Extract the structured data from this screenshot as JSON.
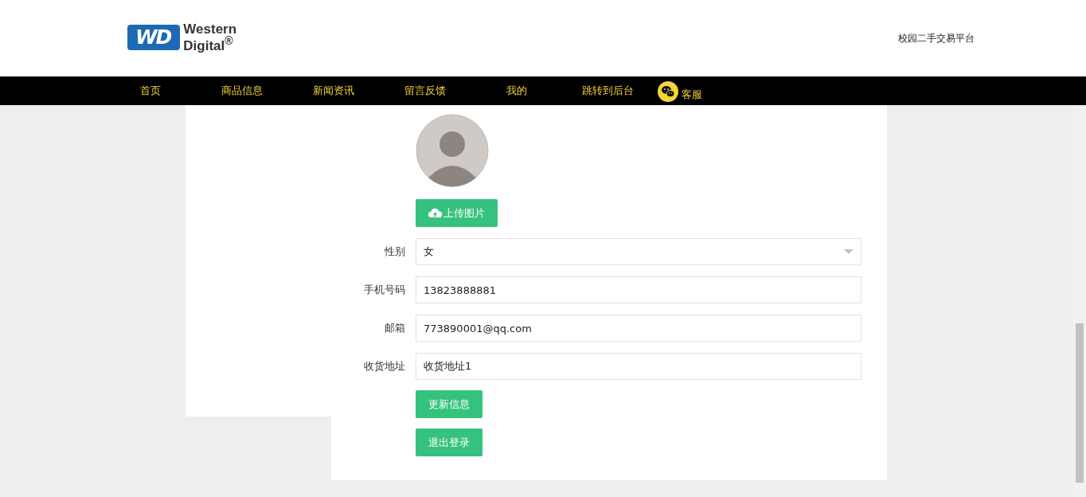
{
  "header": {
    "logo": {
      "mark": "WD",
      "line1": "Western",
      "line2": "Digital$^{®}$"
    },
    "site_name": "校园二手交易平台"
  },
  "nav": {
    "items": [
      "首页",
      "商品信息",
      "新闻资讯",
      "留言反馈",
      "我的",
      "跳转到后台"
    ],
    "service": "客服"
  },
  "profile": {
    "upload_button": "上传图片",
    "fields": [
      {
        "kind": "select",
        "label": "性别",
        "value": "女"
      },
      {
        "kind": "input",
        "label": "手机号码",
        "value": "13823888881"
      },
      {
        "kind": "input",
        "label": "邮箱",
        "value": "773890001@qq.com"
      },
      {
        "kind": "input",
        "label": "收货地址",
        "value": "收货地址1"
      }
    ],
    "buttons": [
      "更新信息",
      "退出登录"
    ]
  }
}
